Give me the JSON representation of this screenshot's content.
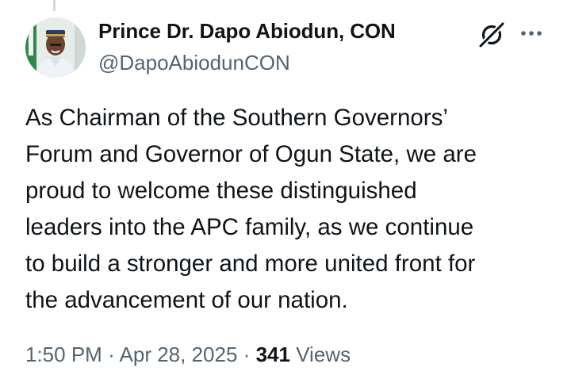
{
  "author": {
    "display_name": "Prince Dr. Dapo Abiodun, CON",
    "handle": "@DapoAbiodunCON"
  },
  "tweet": {
    "lines": [
      "As Chairman of the Southern Governors’",
      "Forum and Governor of Ogun State, we are",
      "proud to welcome these distinguished",
      "leaders into the APC family, as we continue",
      "to build a stronger and more united front for",
      "the advancement of our nation."
    ]
  },
  "meta": {
    "time": "1:50 PM",
    "separator": "·",
    "date": "Apr 28, 2025",
    "views_count": "341",
    "views_label": "Views"
  },
  "icons": {
    "grok": "grok-icon",
    "more": "more-icon"
  },
  "colors": {
    "text": "#0f1419",
    "secondary": "#536471"
  }
}
